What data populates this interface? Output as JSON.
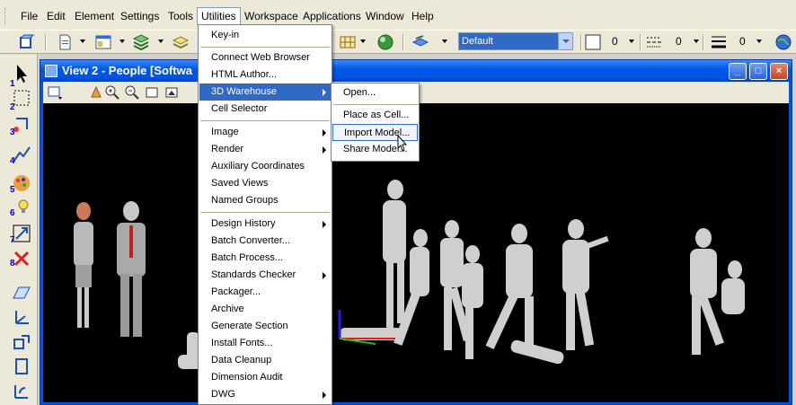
{
  "menubar": {
    "items": [
      "File",
      "Edit",
      "Element",
      "Settings",
      "Tools",
      "Utilities",
      "Workspace",
      "Applications",
      "Window",
      "Help"
    ],
    "active": "Utilities"
  },
  "toolbar": {
    "level_combo": "Default",
    "color_value": "0",
    "style_value": "0",
    "weight_value": "0"
  },
  "palette": {
    "numbers": [
      "1",
      "2",
      "3",
      "4",
      "5",
      "6",
      "7",
      "8"
    ]
  },
  "view": {
    "title": "View 2 - People [Softwa"
  },
  "utilities_menu": {
    "items": [
      {
        "label": "Key-in",
        "submenu": false
      },
      {
        "label": "Connect Web Browser",
        "submenu": false
      },
      {
        "label": "HTML Author...",
        "submenu": false
      },
      {
        "label": "3D Warehouse",
        "submenu": true
      },
      {
        "label": "Cell Selector",
        "submenu": false
      },
      {
        "label": "Image",
        "submenu": true
      },
      {
        "label": "Render",
        "submenu": true
      },
      {
        "label": "Auxiliary Coordinates",
        "submenu": false
      },
      {
        "label": "Saved Views",
        "submenu": false
      },
      {
        "label": "Named Groups",
        "submenu": false
      },
      {
        "label": "Design History",
        "submenu": true
      },
      {
        "label": "Batch Converter...",
        "submenu": false
      },
      {
        "label": "Batch Process...",
        "submenu": false
      },
      {
        "label": "Standards Checker",
        "submenu": true
      },
      {
        "label": "Packager...",
        "submenu": false
      },
      {
        "label": "Archive",
        "submenu": false
      },
      {
        "label": "Generate Section",
        "submenu": false
      },
      {
        "label": "Install Fonts...",
        "submenu": false
      },
      {
        "label": "Data Cleanup",
        "submenu": false
      },
      {
        "label": "Dimension Audit",
        "submenu": false
      },
      {
        "label": "DWG",
        "submenu": true
      }
    ],
    "highlighted": "3D Warehouse"
  },
  "warehouse_submenu": {
    "items": [
      "Open...",
      "Place as Cell...",
      "Import Model...",
      "Share Model..."
    ],
    "highlighted": "Import Model..."
  }
}
